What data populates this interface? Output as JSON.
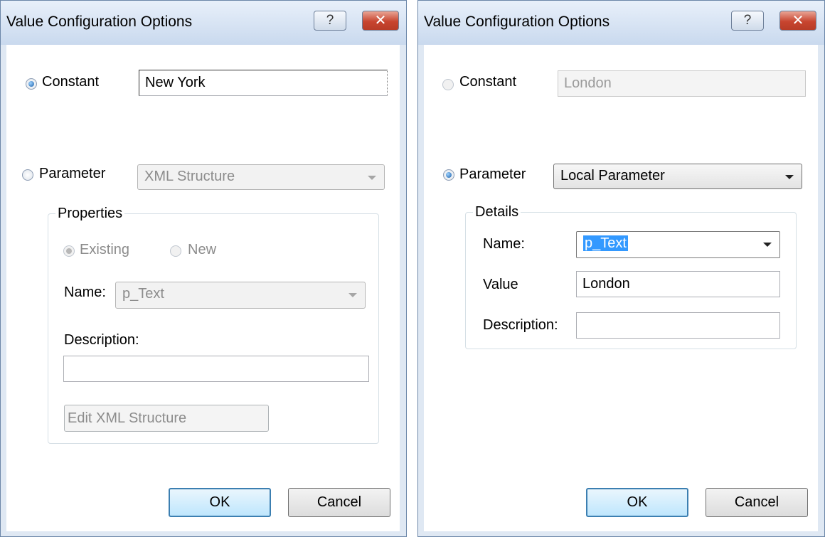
{
  "left_dialog": {
    "title": "Value Configuration Options",
    "help_symbol": "?",
    "close_symbol": "✕",
    "constant": {
      "label": "Constant",
      "selected": true,
      "value": "New York"
    },
    "parameter": {
      "label": "Parameter",
      "selected": false,
      "type_value": "XML Structure",
      "group_title": "Properties",
      "existing_label": "Existing",
      "new_label": "New",
      "name_label": "Name:",
      "name_value": "p_Text",
      "description_label": "Description:",
      "description_value": "",
      "edit_button_label": "Edit XML Structure"
    },
    "ok_label": "OK",
    "cancel_label": "Cancel"
  },
  "right_dialog": {
    "title": "Value Configuration Options",
    "help_symbol": "?",
    "close_symbol": "✕",
    "constant": {
      "label": "Constant",
      "selected": false,
      "value": "London"
    },
    "parameter": {
      "label": "Parameter",
      "selected": true,
      "type_value": "Local Parameter",
      "group_title": "Details",
      "name_label": "Name:",
      "name_value": "p_Text",
      "value_label": "Value",
      "value_value": "London",
      "description_label": "Description:",
      "description_value": ""
    },
    "ok_label": "OK",
    "cancel_label": "Cancel"
  }
}
